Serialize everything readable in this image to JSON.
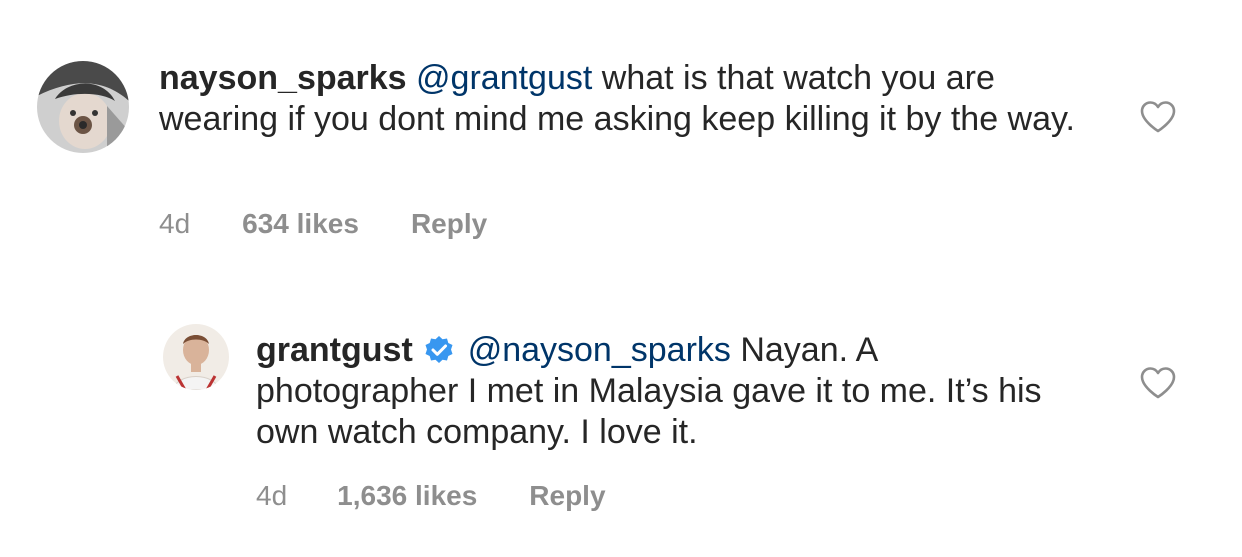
{
  "comments": [
    {
      "username": "nayson_sparks",
      "mention": "@grantgust",
      "body": " what is that watch you are wearing if you dont mind me asking keep killing it by the way.",
      "time": "4d",
      "likes": "634 likes",
      "reply_label": "Reply",
      "verified": false
    },
    {
      "username": "grantgust",
      "mention": "@nayson_sparks",
      "body": " Nayan. A photographer I met in Malaysia gave it to me. It’s his own watch company. I love it.",
      "time": "4d",
      "likes": "1,636 likes",
      "reply_label": "Reply",
      "verified": true
    }
  ],
  "colors": {
    "text": "#262626",
    "mention": "#003569",
    "meta": "#8e8e8e",
    "verified": "#3897f0"
  },
  "icons": {
    "like": "heart-outline-icon",
    "verified": "verified-badge-icon"
  }
}
